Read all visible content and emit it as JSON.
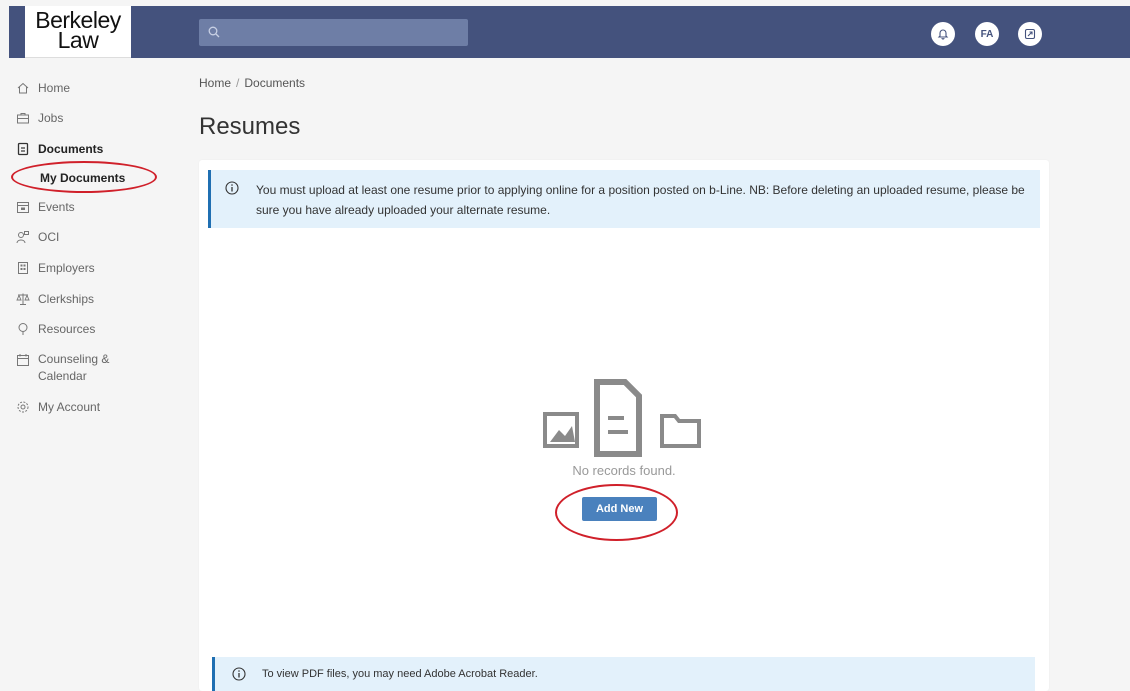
{
  "header": {
    "logo_line1": "Berkeley",
    "logo_line2": "Law",
    "search_placeholder": "",
    "avatar_initials": "FA",
    "colors": {
      "bar": "#44527d",
      "search": "#6e7ea6"
    }
  },
  "sidebar": {
    "items": [
      {
        "label": "Home",
        "icon": "home-icon"
      },
      {
        "label": "Jobs",
        "icon": "briefcase-icon"
      },
      {
        "label": "Documents",
        "icon": "documents-icon"
      },
      {
        "label": "My Documents",
        "icon": ""
      },
      {
        "label": "Events",
        "icon": "calendar-icon"
      },
      {
        "label": "OCI",
        "icon": "oci-icon"
      },
      {
        "label": "Employers",
        "icon": "building-icon"
      },
      {
        "label": "Clerkships",
        "icon": "scales-icon"
      },
      {
        "label": "Resources",
        "icon": "lightbulb-icon"
      },
      {
        "label": "Counseling &",
        "label2": "Calendar",
        "icon": "calendar-icon"
      },
      {
        "label": "My Account",
        "icon": "gear-icon"
      }
    ]
  },
  "breadcrumb": {
    "home": "Home",
    "separator": "/",
    "current": "Documents"
  },
  "page_title": "Resumes",
  "alert": {
    "text": "You must upload at least one resume prior to applying online for a position posted on b-Line. NB: Before deleting an uploaded resume, please be sure you have already uploaded your alternate resume."
  },
  "empty_state": {
    "message": "No records found.",
    "button_label": "Add New"
  },
  "footer_alert": {
    "text": "To view PDF files, you may need Adobe Acrobat Reader."
  },
  "accent_colors": {
    "annotation": "#d0202a",
    "button": "#4a81bd",
    "alert_border": "#1f6fb2",
    "alert_bg": "#e3f1fb"
  }
}
